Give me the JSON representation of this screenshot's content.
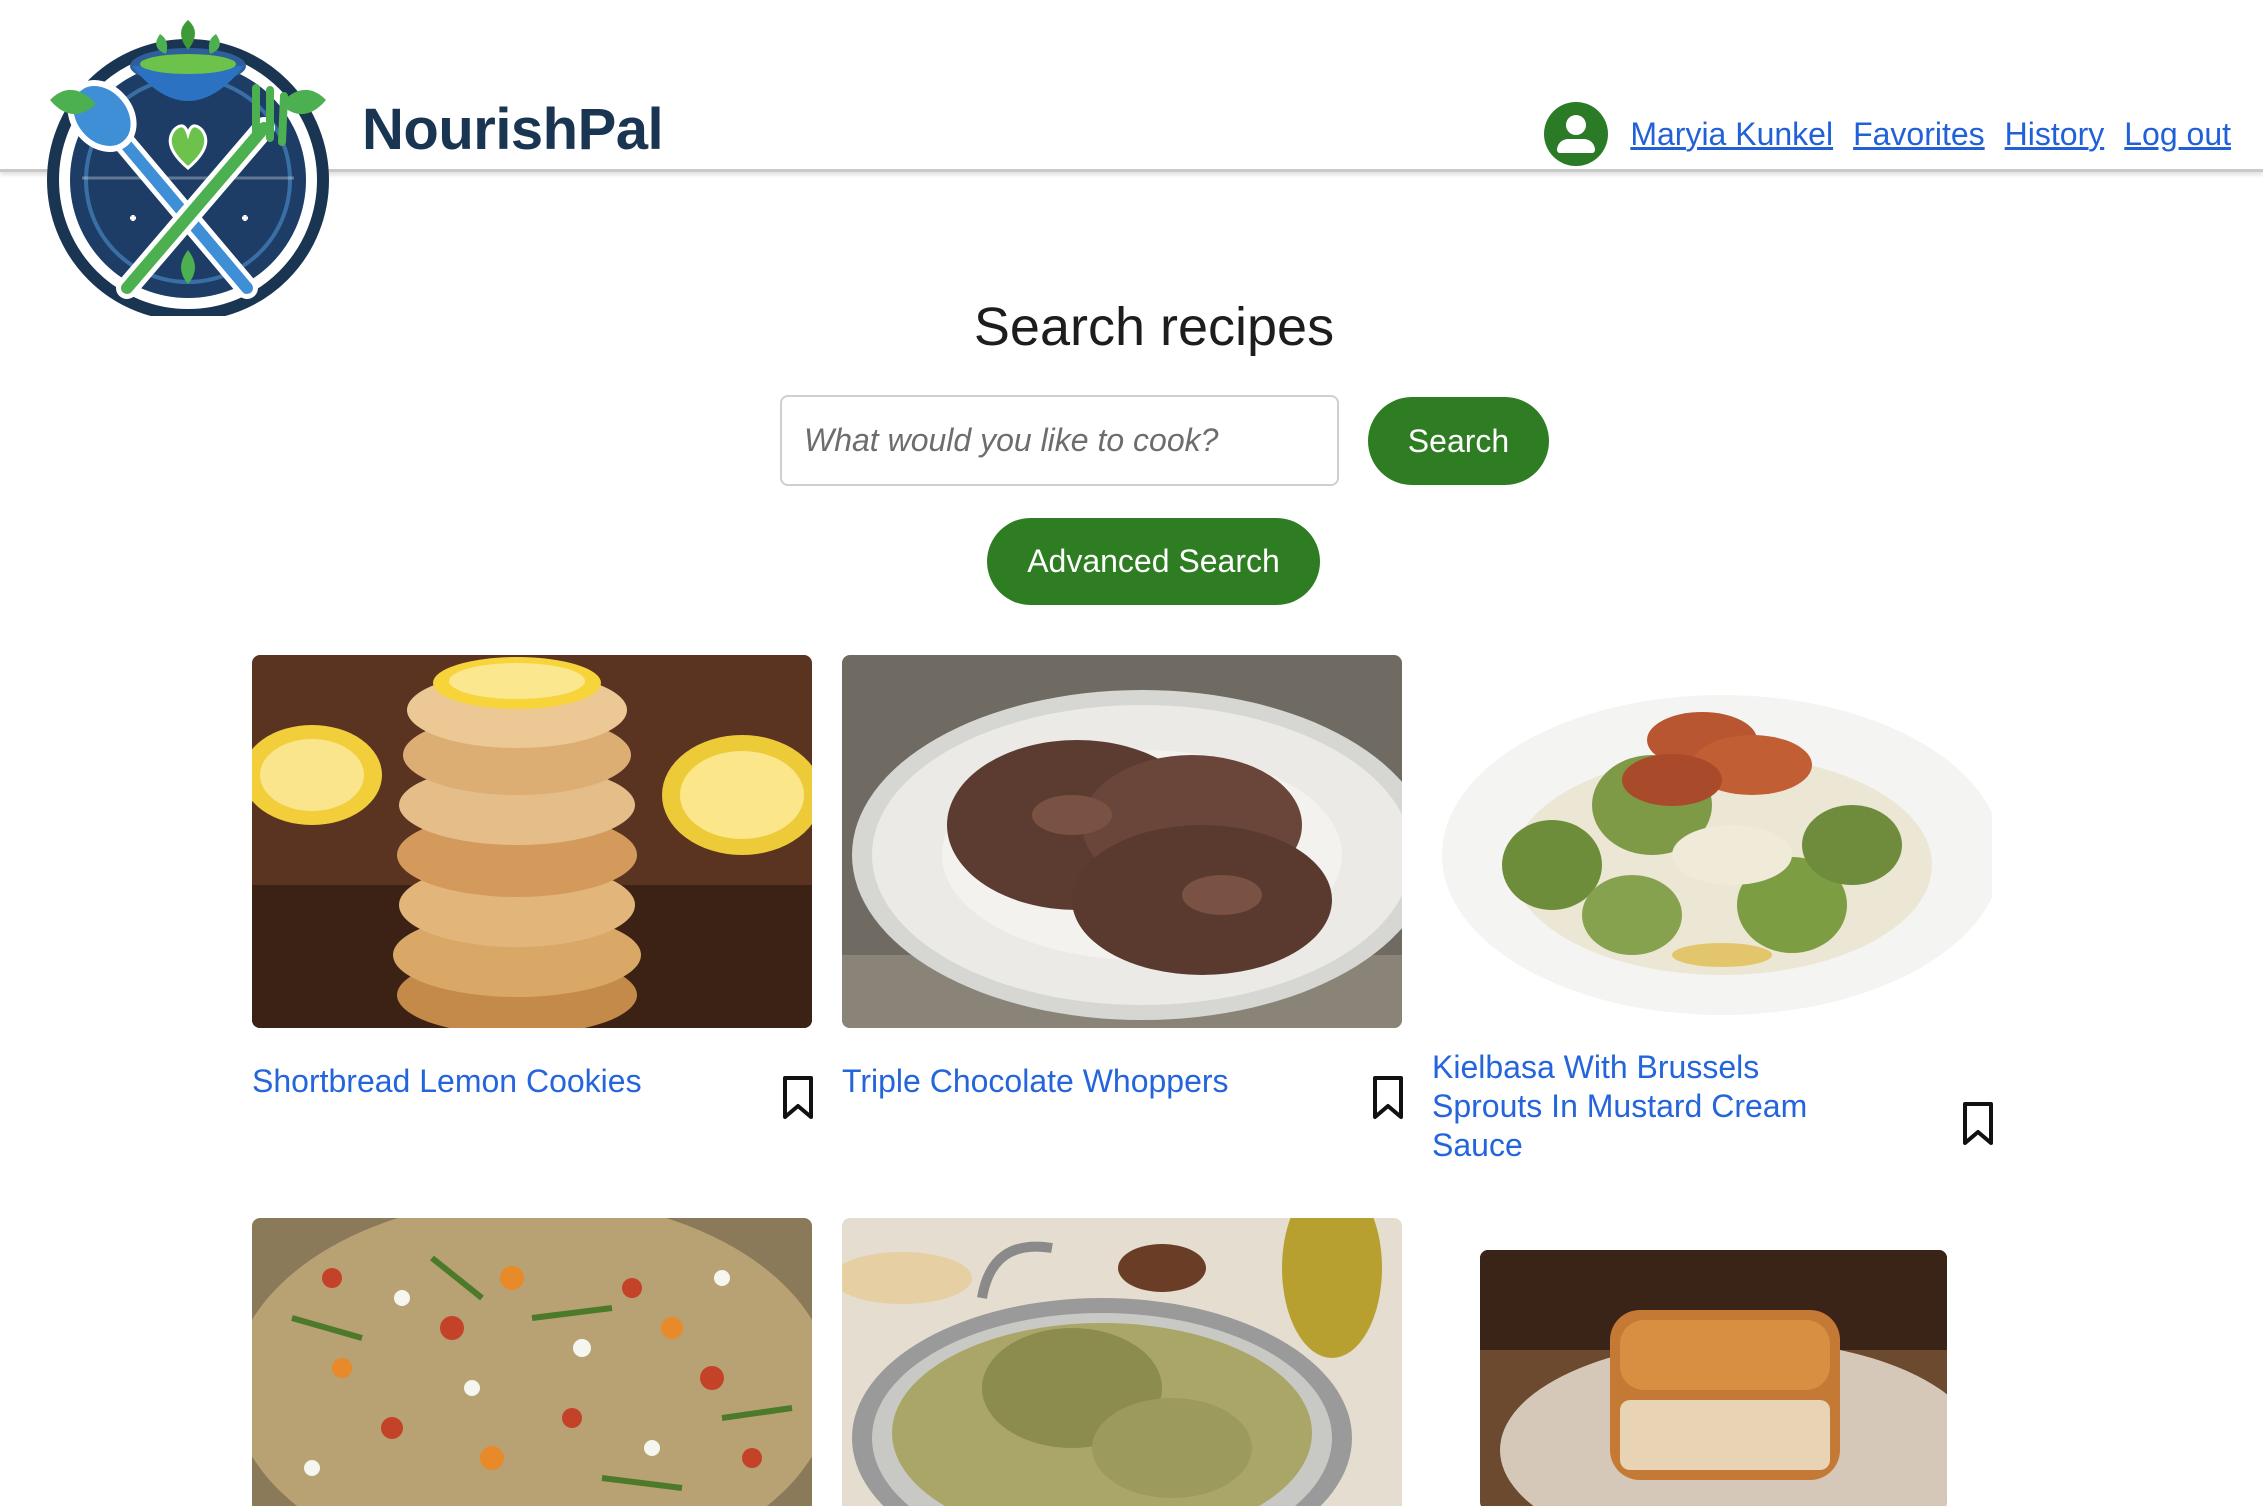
{
  "brand": {
    "name": "NourishPal"
  },
  "nav": {
    "user_name": "Maryia Kunkel",
    "favorites": "Favorites",
    "history": "History",
    "logout": "Log out"
  },
  "search": {
    "title": "Search recipes",
    "placeholder": "What would you like to cook?",
    "button": "Search",
    "advanced": "Advanced Search"
  },
  "recipes": [
    {
      "title": "Shortbread Lemon Cookies"
    },
    {
      "title": "Triple Chocolate Whoppers"
    },
    {
      "title": "Kielbasa With Brussels Sprouts In Mustard Cream Sauce"
    }
  ],
  "colors": {
    "accent": "#2e7d22",
    "link": "#2465dc",
    "brand": "#1a3552"
  }
}
